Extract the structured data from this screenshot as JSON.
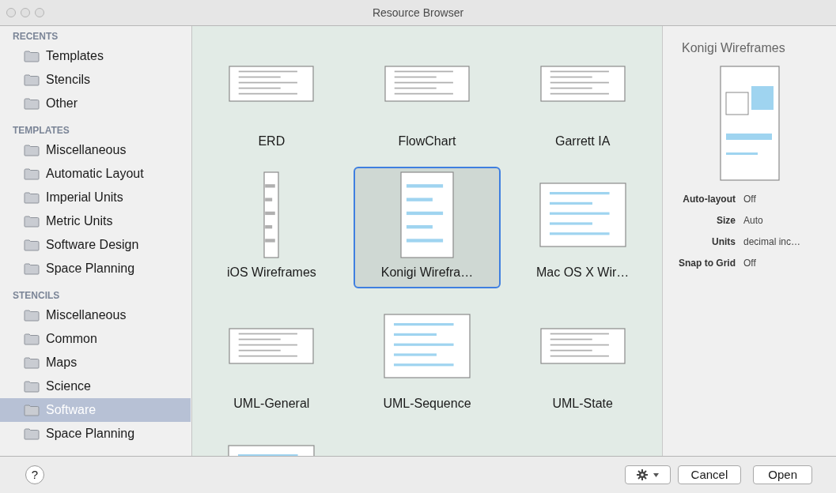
{
  "window": {
    "title": "Resource Browser"
  },
  "sidebar": {
    "sections": [
      {
        "heading": "RECENTS",
        "items": [
          {
            "label": "Templates",
            "selected": false
          },
          {
            "label": "Stencils",
            "selected": false
          },
          {
            "label": "Other",
            "selected": false
          }
        ]
      },
      {
        "heading": "TEMPLATES",
        "items": [
          {
            "label": "Miscellaneous",
            "selected": false
          },
          {
            "label": "Automatic Layout",
            "selected": false
          },
          {
            "label": "Imperial Units",
            "selected": false
          },
          {
            "label": "Metric Units",
            "selected": false
          },
          {
            "label": "Software Design",
            "selected": false
          },
          {
            "label": "Space Planning",
            "selected": false
          }
        ]
      },
      {
        "heading": "STENCILS",
        "items": [
          {
            "label": "Miscellaneous",
            "selected": false
          },
          {
            "label": "Common",
            "selected": false
          },
          {
            "label": "Maps",
            "selected": false
          },
          {
            "label": "Science",
            "selected": false
          },
          {
            "label": "Software",
            "selected": true
          },
          {
            "label": "Space Planning",
            "selected": false
          }
        ]
      }
    ]
  },
  "grid": {
    "items": [
      {
        "label": "ERD",
        "kind": "landscape",
        "selected": false
      },
      {
        "label": "FlowChart",
        "kind": "landscape",
        "selected": false
      },
      {
        "label": "Garrett IA",
        "kind": "landscape",
        "selected": false
      },
      {
        "label": "iOS Wireframes",
        "kind": "narrow",
        "selected": false
      },
      {
        "label": "Konigi Wirefra…",
        "kind": "portrait",
        "selected": true
      },
      {
        "label": "Mac OS X Wir…",
        "kind": "square",
        "selected": false
      },
      {
        "label": "UML-General",
        "kind": "landscape",
        "selected": false
      },
      {
        "label": "UML-Sequence",
        "kind": "square",
        "selected": false
      },
      {
        "label": "UML-State",
        "kind": "landscape",
        "selected": false
      },
      {
        "kind": "square",
        "selected": false
      }
    ]
  },
  "details": {
    "title": "Konigi Wireframes",
    "properties": [
      {
        "name": "Auto-layout",
        "value": "Off"
      },
      {
        "name": "Size",
        "value": "Auto"
      },
      {
        "name": "Units",
        "value": "decimal inc…"
      },
      {
        "name": "Snap to Grid",
        "value": "Off"
      }
    ]
  },
  "footer": {
    "help": "?",
    "cancel": "Cancel",
    "open": "Open"
  }
}
